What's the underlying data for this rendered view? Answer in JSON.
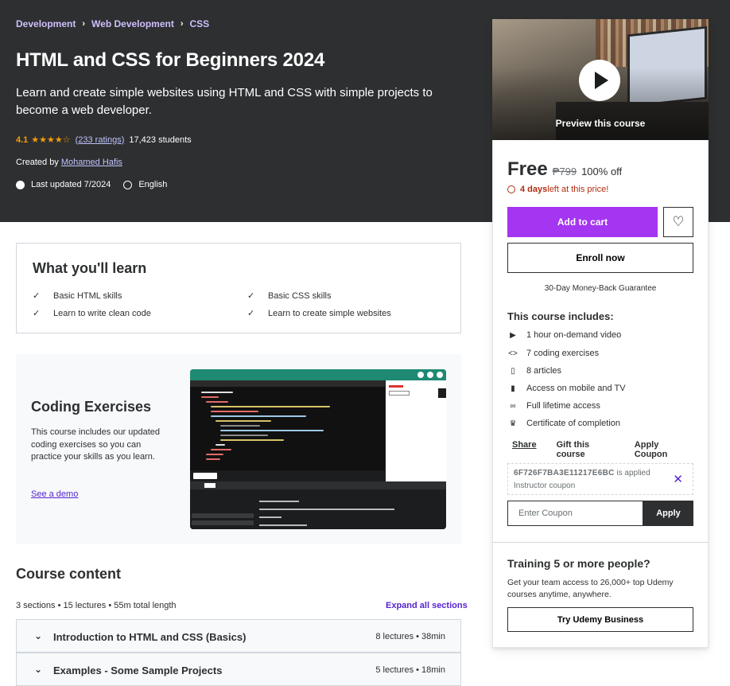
{
  "breadcrumb": [
    "Development",
    "Web Development",
    "CSS"
  ],
  "course": {
    "title": "HTML and CSS for Beginners 2024",
    "subtitle": "Learn and create simple websites using HTML and CSS with simple projects to become a web developer.",
    "rating": "4.1",
    "stars": "★★★★☆",
    "ratings_count": "(233 ratings)",
    "students": "17,423 students",
    "created_by_label": "Created by",
    "instructor": "Mohamed Hafis",
    "last_updated": "Last updated 7/2024",
    "language": "English"
  },
  "learn": {
    "title": "What you'll learn",
    "items": [
      "Basic HTML skills",
      "Basic CSS skills",
      "Learn to write clean code",
      "Learn to create simple websites"
    ]
  },
  "coding": {
    "title": "Coding Exercises",
    "description": "This course includes our updated coding exercises so you can practice your skills as you learn.",
    "demo_link": "See a demo"
  },
  "content": {
    "title": "Course content",
    "meta": "3 sections • 15 lectures • 55m total length",
    "expand": "Expand all sections",
    "sections": [
      {
        "title": "Introduction to HTML and CSS (Basics)",
        "info": "8 lectures • 38min"
      },
      {
        "title": "Examples - Some Sample Projects",
        "info": "5 lectures • 18min"
      }
    ]
  },
  "sidebar": {
    "preview": "Preview this course",
    "price": "Free",
    "original_price": "₱799",
    "discount": "100% off",
    "timer_bold": "4 days",
    "timer_rest": " left at this price!",
    "add_to_cart": "Add to cart",
    "enroll": "Enroll now",
    "guarantee": "30-Day Money-Back Guarantee",
    "includes_title": "This course includes:",
    "includes": [
      "1 hour on-demand video",
      "7 coding exercises",
      "8 articles",
      "Access on mobile and TV",
      "Full lifetime access",
      "Certificate of completion"
    ],
    "share": "Share",
    "gift": "Gift this course",
    "apply_coupon": "Apply Coupon",
    "coupon_code": "6F726F7BA3E11217E6BC",
    "coupon_applied": " is applied",
    "coupon_sub": "Instructor coupon",
    "coupon_placeholder": "Enter Coupon",
    "apply": "Apply",
    "biz_title": "Training 5 or more people?",
    "biz_desc": "Get your team access to 26,000+ top Udemy courses anytime, anywhere.",
    "biz_button": "Try Udemy Business"
  },
  "colors": {
    "hero_bg": "#2d2f31",
    "accent": "#a435f0",
    "link": "#5624d0",
    "star": "#f69c08"
  }
}
